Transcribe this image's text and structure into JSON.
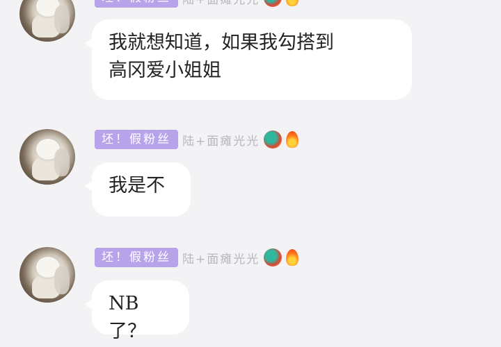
{
  "messages": [
    {
      "badge": "坯！假粉丝",
      "nickname": "陆+面瘫光光",
      "text_line1": "我就想知道，如果我勾搭到",
      "text_line2": "高冈爱小姐姐"
    },
    {
      "badge": "坯！假粉丝",
      "nickname": "陆+面瘫光光",
      "text_line1": "我是不"
    },
    {
      "badge": "坯！假粉丝",
      "nickname": "陆+面瘫光光",
      "text_line1": "NB了？"
    }
  ],
  "icons": {
    "badge_decor_1": "dragon-icon",
    "badge_decor_2": "fire-icon"
  },
  "colors": {
    "background": "#f3f3f5",
    "badge": "#b7a3ea",
    "bubble": "#ffffff",
    "nickname": "#b8b8bc"
  }
}
